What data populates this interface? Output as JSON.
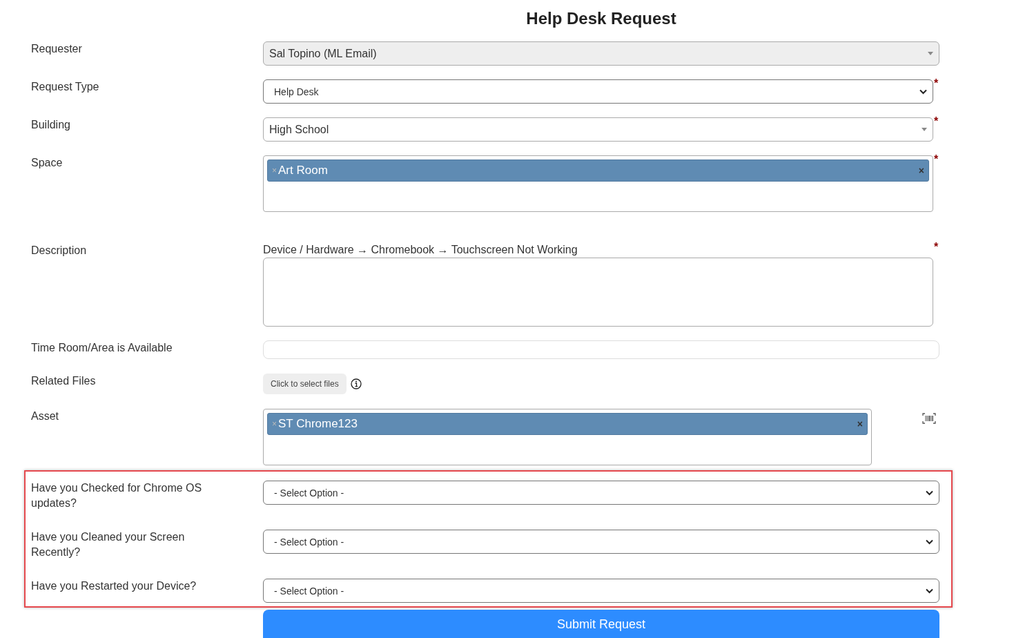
{
  "title": "Help Desk Request",
  "fields": [
    {
      "kind": "select2",
      "label": "Requester",
      "value": "Sal Topino (ML Email)",
      "disabled": true
    },
    {
      "kind": "select",
      "label": "Request Type",
      "value": "Help Desk",
      "required_mark": "*"
    },
    {
      "kind": "select2",
      "label": "Building",
      "value": "High School",
      "disabled": false,
      "required_mark": "*"
    },
    {
      "kind": "tags",
      "label": "Space",
      "tags": [
        {
          "text": "Art Room",
          "remove": "×",
          "clear": "×"
        }
      ],
      "required_mark": "*"
    },
    {
      "kind": "textarea",
      "label": "Description",
      "hint": "Device / Hardware → Chromebook → Touchscreen Not Working",
      "required_mark": "*"
    },
    {
      "kind": "text",
      "label": "Time Room/Area is Available"
    },
    {
      "kind": "file",
      "label": "Related Files",
      "button": "Click to select files"
    },
    {
      "kind": "tags",
      "label": "Asset",
      "tags": [
        {
          "text": "ST Chrome123",
          "remove": "×",
          "clear": "×"
        }
      ],
      "scanner": true
    }
  ],
  "question_group": {
    "highlighted": true,
    "fields": [
      {
        "kind": "select",
        "label": "Have you Checked for Chrome OS updates?",
        "value": "- Select Option -"
      },
      {
        "kind": "select",
        "label": "Have you Cleaned your Screen Recently?",
        "value": "- Select Option -"
      },
      {
        "kind": "select",
        "label": "Have you Restarted your Device?",
        "value": "- Select Option -"
      }
    ]
  },
  "submit_button": "Submit Request"
}
